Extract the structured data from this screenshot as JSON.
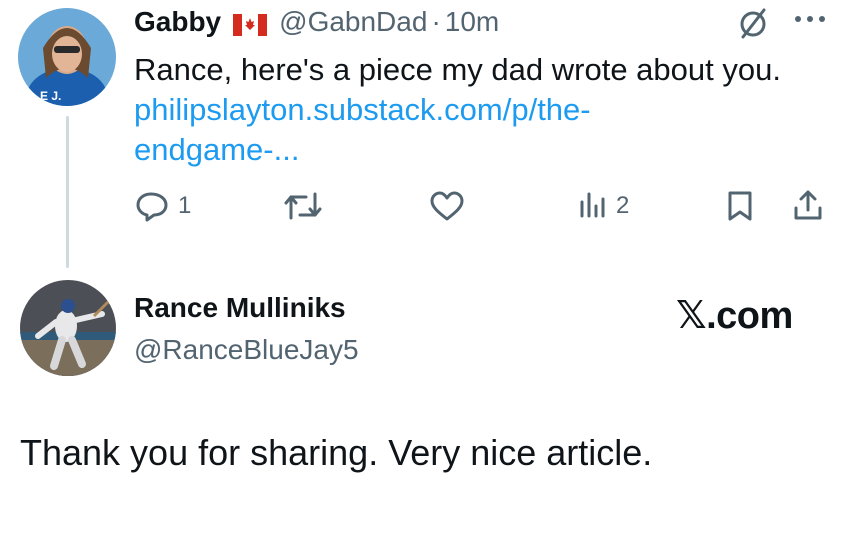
{
  "tweet": {
    "author_name": "Gabby",
    "flag": "🇨🇦",
    "handle": "@GabnDad",
    "separator": "·",
    "time": "10m",
    "text": "Rance, here's a piece my dad wrote about you.",
    "link_line1": "philipslayton.substack.com/p/the-",
    "link_line2": "endgame-...",
    "actions": {
      "reply_count": "1",
      "views_count": "2"
    }
  },
  "reply": {
    "author_name": "Rance Mulliniks",
    "handle": "@RanceBlueJay5",
    "brand": "𝕏.com",
    "text": "Thank you for sharing. Very nice article."
  },
  "colors": {
    "text": "#0f1419",
    "muted": "#536471",
    "link": "#1d9bf0",
    "thread_line": "#cfd9de",
    "canada_red": "#d52b1e"
  }
}
